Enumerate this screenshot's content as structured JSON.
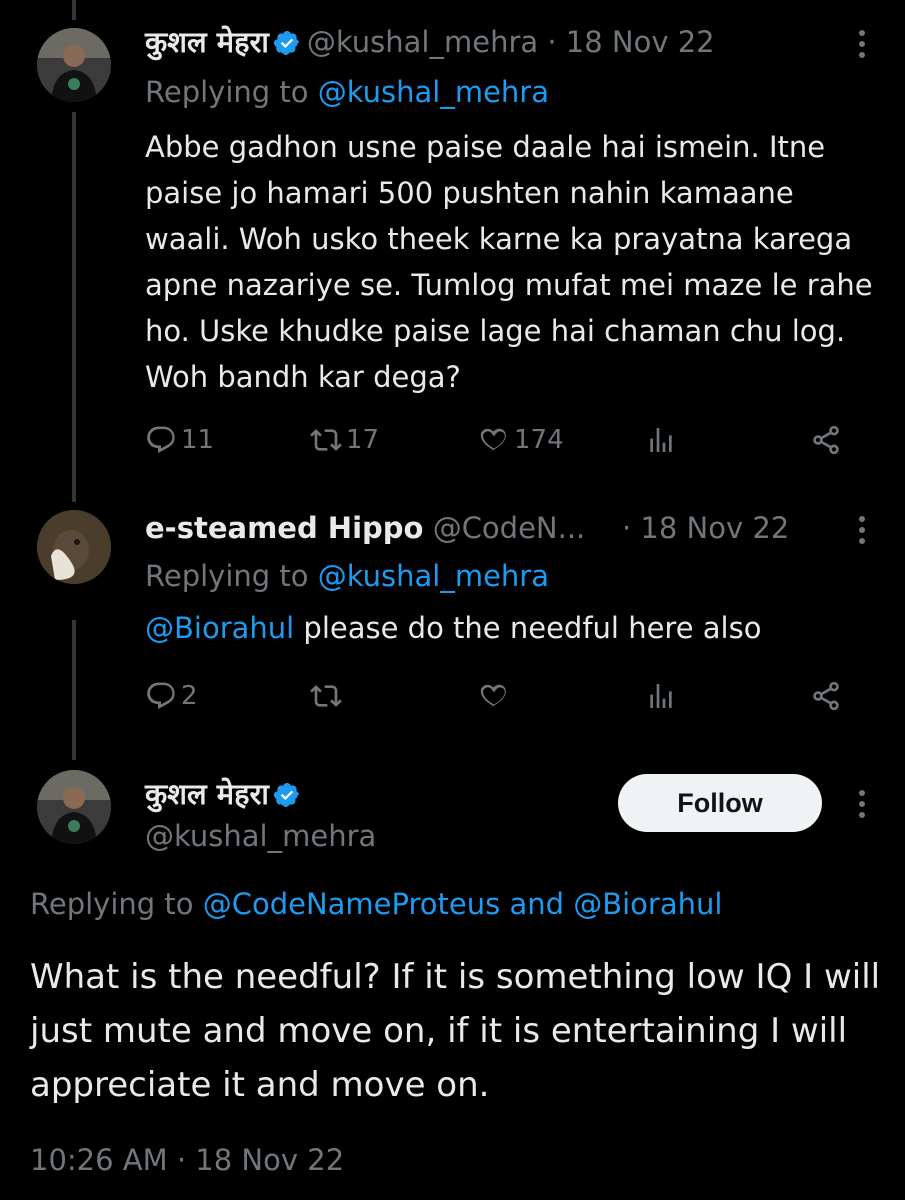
{
  "tweets": [
    {
      "display_name": "कुशल मेहरा",
      "handle": "@kushal_mehra",
      "date": "· 18 Nov 22",
      "replying_prefix": "Replying to",
      "replying_to": "@kushal_mehra",
      "text": "Abbe gadhon usne paise daale hai ismein. Itne paise jo hamari 500 pushten nahin kamaane waali. Woh usko theek karne ka prayatna karega apne nazariye se. Tumlog mufat mei maze le rahe ho. Uske khudke paise lage hai chaman chu log. Woh bandh kar dega?",
      "replies": "11",
      "retweets": "17",
      "likes": "174"
    },
    {
      "display_name": "e-steamed Hippo",
      "handle": "@CodeN...",
      "date": "· 18 Nov 22",
      "replying_prefix": "Replying to",
      "replying_to": "@kushal_mehra",
      "mention": "@Biorahul",
      "text": " please do the needful here also",
      "replies": "2",
      "retweets": "",
      "likes": ""
    }
  ],
  "main_tweet": {
    "display_name": "कुशल मेहरा",
    "handle": "@kushal_mehra",
    "follow_label": "Follow",
    "replying_prefix": "Replying to",
    "replying_to": "@CodeNameProteus and @Biorahul",
    "text": "What is the needful? If it is something low IQ I will just mute and move on, if it is entertaining I will appreciate it and move on.",
    "timestamp": "10:26 AM · 18 Nov 22"
  },
  "colors": {
    "background": "#000000",
    "text": "#e7e9ea",
    "muted": "#71767b",
    "link": "#1d9bf0",
    "thread_line": "#333639"
  },
  "icons": [
    "verified-badge-icon",
    "more-icon",
    "reply-icon",
    "retweet-icon",
    "like-icon",
    "views-icon",
    "share-icon"
  ]
}
